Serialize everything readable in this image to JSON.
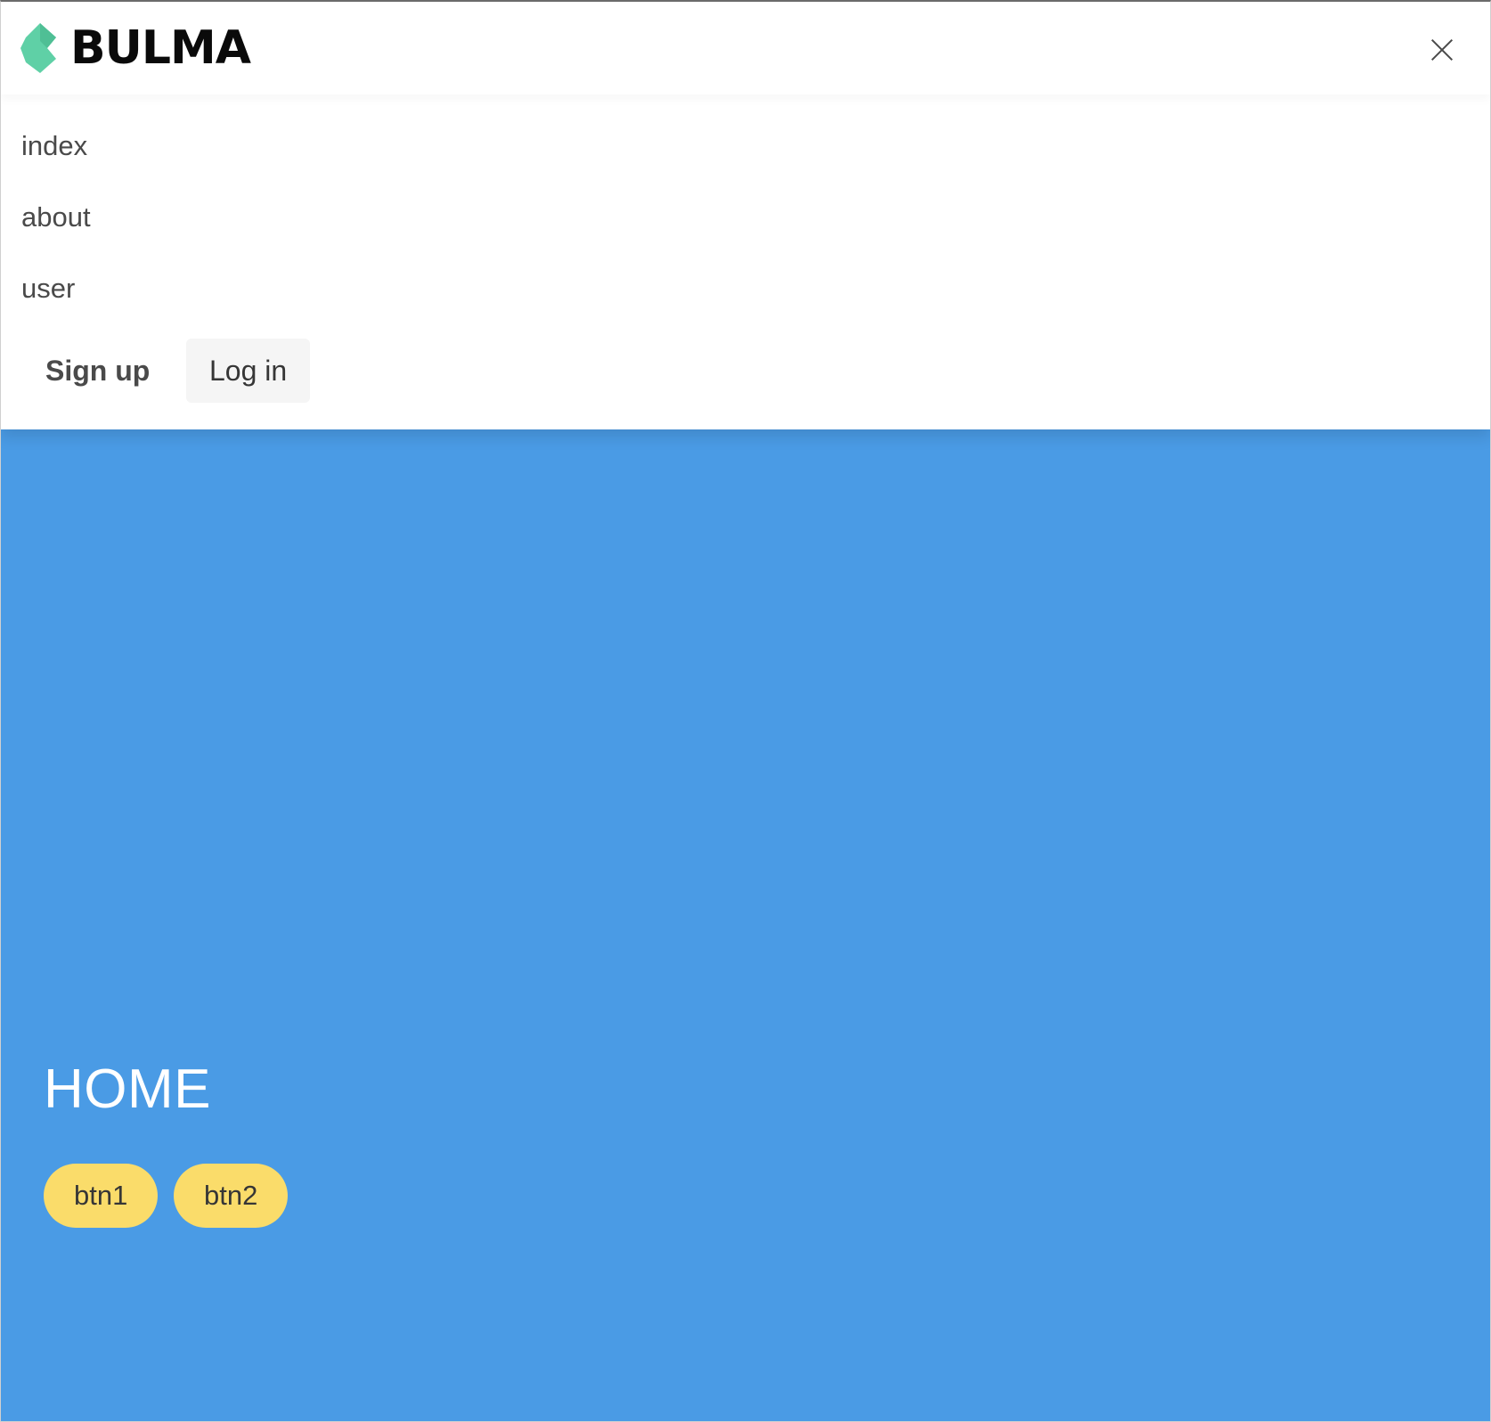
{
  "brand": {
    "name": "BULMA",
    "logo_icon": "bulma-logo-icon",
    "logo_color": "#5fd0a6"
  },
  "navbar": {
    "close_icon": "close-icon",
    "items": [
      {
        "label": "index"
      },
      {
        "label": "about"
      },
      {
        "label": "user"
      }
    ],
    "signup_label": "Sign up",
    "login_label": "Log in"
  },
  "hero": {
    "title": "HOME",
    "background_color": "#4a9be5",
    "buttons": [
      {
        "label": "btn1"
      },
      {
        "label": "btn2"
      }
    ],
    "button_color": "#fadc6a"
  }
}
